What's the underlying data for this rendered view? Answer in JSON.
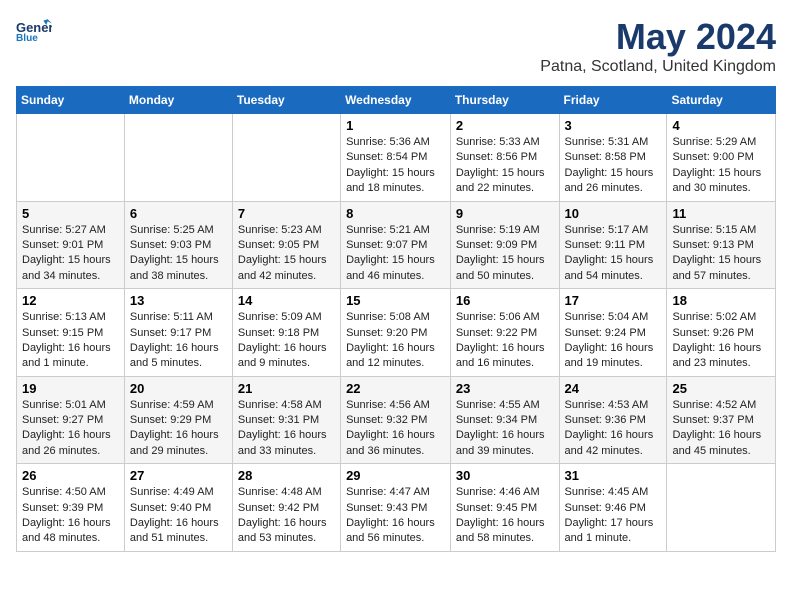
{
  "header": {
    "logo_general": "General",
    "logo_blue": "Blue",
    "month_title": "May 2024",
    "location": "Patna, Scotland, United Kingdom"
  },
  "days_of_week": [
    "Sunday",
    "Monday",
    "Tuesday",
    "Wednesday",
    "Thursday",
    "Friday",
    "Saturday"
  ],
  "weeks": [
    [
      {
        "day": "",
        "info": ""
      },
      {
        "day": "",
        "info": ""
      },
      {
        "day": "",
        "info": ""
      },
      {
        "day": "1",
        "info": "Sunrise: 5:36 AM\nSunset: 8:54 PM\nDaylight: 15 hours\nand 18 minutes."
      },
      {
        "day": "2",
        "info": "Sunrise: 5:33 AM\nSunset: 8:56 PM\nDaylight: 15 hours\nand 22 minutes."
      },
      {
        "day": "3",
        "info": "Sunrise: 5:31 AM\nSunset: 8:58 PM\nDaylight: 15 hours\nand 26 minutes."
      },
      {
        "day": "4",
        "info": "Sunrise: 5:29 AM\nSunset: 9:00 PM\nDaylight: 15 hours\nand 30 minutes."
      }
    ],
    [
      {
        "day": "5",
        "info": "Sunrise: 5:27 AM\nSunset: 9:01 PM\nDaylight: 15 hours\nand 34 minutes."
      },
      {
        "day": "6",
        "info": "Sunrise: 5:25 AM\nSunset: 9:03 PM\nDaylight: 15 hours\nand 38 minutes."
      },
      {
        "day": "7",
        "info": "Sunrise: 5:23 AM\nSunset: 9:05 PM\nDaylight: 15 hours\nand 42 minutes."
      },
      {
        "day": "8",
        "info": "Sunrise: 5:21 AM\nSunset: 9:07 PM\nDaylight: 15 hours\nand 46 minutes."
      },
      {
        "day": "9",
        "info": "Sunrise: 5:19 AM\nSunset: 9:09 PM\nDaylight: 15 hours\nand 50 minutes."
      },
      {
        "day": "10",
        "info": "Sunrise: 5:17 AM\nSunset: 9:11 PM\nDaylight: 15 hours\nand 54 minutes."
      },
      {
        "day": "11",
        "info": "Sunrise: 5:15 AM\nSunset: 9:13 PM\nDaylight: 15 hours\nand 57 minutes."
      }
    ],
    [
      {
        "day": "12",
        "info": "Sunrise: 5:13 AM\nSunset: 9:15 PM\nDaylight: 16 hours\nand 1 minute."
      },
      {
        "day": "13",
        "info": "Sunrise: 5:11 AM\nSunset: 9:17 PM\nDaylight: 16 hours\nand 5 minutes."
      },
      {
        "day": "14",
        "info": "Sunrise: 5:09 AM\nSunset: 9:18 PM\nDaylight: 16 hours\nand 9 minutes."
      },
      {
        "day": "15",
        "info": "Sunrise: 5:08 AM\nSunset: 9:20 PM\nDaylight: 16 hours\nand 12 minutes."
      },
      {
        "day": "16",
        "info": "Sunrise: 5:06 AM\nSunset: 9:22 PM\nDaylight: 16 hours\nand 16 minutes."
      },
      {
        "day": "17",
        "info": "Sunrise: 5:04 AM\nSunset: 9:24 PM\nDaylight: 16 hours\nand 19 minutes."
      },
      {
        "day": "18",
        "info": "Sunrise: 5:02 AM\nSunset: 9:26 PM\nDaylight: 16 hours\nand 23 minutes."
      }
    ],
    [
      {
        "day": "19",
        "info": "Sunrise: 5:01 AM\nSunset: 9:27 PM\nDaylight: 16 hours\nand 26 minutes."
      },
      {
        "day": "20",
        "info": "Sunrise: 4:59 AM\nSunset: 9:29 PM\nDaylight: 16 hours\nand 29 minutes."
      },
      {
        "day": "21",
        "info": "Sunrise: 4:58 AM\nSunset: 9:31 PM\nDaylight: 16 hours\nand 33 minutes."
      },
      {
        "day": "22",
        "info": "Sunrise: 4:56 AM\nSunset: 9:32 PM\nDaylight: 16 hours\nand 36 minutes."
      },
      {
        "day": "23",
        "info": "Sunrise: 4:55 AM\nSunset: 9:34 PM\nDaylight: 16 hours\nand 39 minutes."
      },
      {
        "day": "24",
        "info": "Sunrise: 4:53 AM\nSunset: 9:36 PM\nDaylight: 16 hours\nand 42 minutes."
      },
      {
        "day": "25",
        "info": "Sunrise: 4:52 AM\nSunset: 9:37 PM\nDaylight: 16 hours\nand 45 minutes."
      }
    ],
    [
      {
        "day": "26",
        "info": "Sunrise: 4:50 AM\nSunset: 9:39 PM\nDaylight: 16 hours\nand 48 minutes."
      },
      {
        "day": "27",
        "info": "Sunrise: 4:49 AM\nSunset: 9:40 PM\nDaylight: 16 hours\nand 51 minutes."
      },
      {
        "day": "28",
        "info": "Sunrise: 4:48 AM\nSunset: 9:42 PM\nDaylight: 16 hours\nand 53 minutes."
      },
      {
        "day": "29",
        "info": "Sunrise: 4:47 AM\nSunset: 9:43 PM\nDaylight: 16 hours\nand 56 minutes."
      },
      {
        "day": "30",
        "info": "Sunrise: 4:46 AM\nSunset: 9:45 PM\nDaylight: 16 hours\nand 58 minutes."
      },
      {
        "day": "31",
        "info": "Sunrise: 4:45 AM\nSunset: 9:46 PM\nDaylight: 17 hours\nand 1 minute."
      },
      {
        "day": "",
        "info": ""
      }
    ]
  ]
}
